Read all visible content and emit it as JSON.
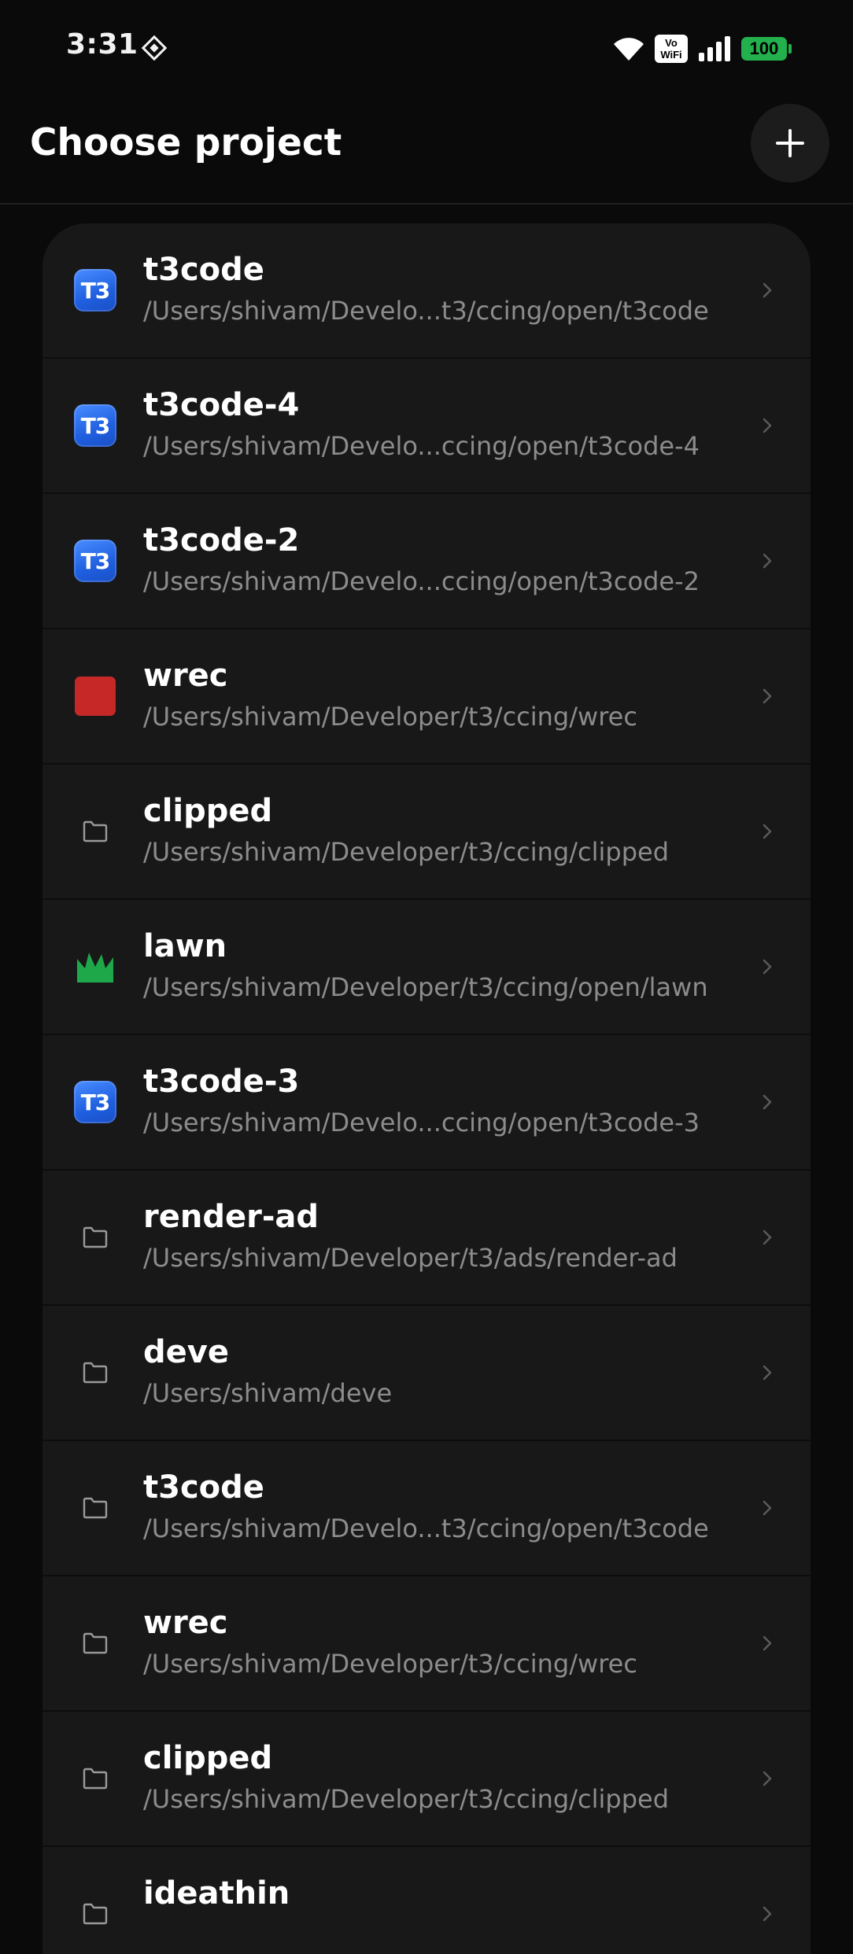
{
  "status_bar": {
    "time": "3:31",
    "vowifi_top": "Vo",
    "vowifi_bottom": "WiFi",
    "battery": "100",
    "icons": [
      "app-notification-icon",
      "wifi-icon",
      "vowifi-icon",
      "signal-icon",
      "battery-icon"
    ]
  },
  "header": {
    "title": "Choose project",
    "add_icon": "plus-icon"
  },
  "colors": {
    "background": "#0a0a0a",
    "card": "#181818",
    "path_text": "#8c8c8c",
    "battery": "#22b14c",
    "t3_blue": "#2a6cf0",
    "wrec_red": "#c62828",
    "lawn_green": "#1fa84a"
  },
  "projects": [
    {
      "name": "t3code",
      "path": "/Users/shivam/Develo...t3/ccing/open/t3code",
      "icon": "t3-icon"
    },
    {
      "name": "t3code-4",
      "path": "/Users/shivam/Develo...ccing/open/t3code-4",
      "icon": "t3-icon"
    },
    {
      "name": "t3code-2",
      "path": "/Users/shivam/Develo...ccing/open/t3code-2",
      "icon": "t3-icon"
    },
    {
      "name": "wrec",
      "path": "/Users/shivam/Developer/t3/ccing/wrec",
      "icon": "red-square-icon"
    },
    {
      "name": "clipped",
      "path": "/Users/shivam/Developer/t3/ccing/clipped",
      "icon": "folder-icon"
    },
    {
      "name": "lawn",
      "path": "/Users/shivam/Developer/t3/ccing/open/lawn",
      "icon": "grass-icon"
    },
    {
      "name": "t3code-3",
      "path": "/Users/shivam/Develo...ccing/open/t3code-3",
      "icon": "t3-icon"
    },
    {
      "name": "render-ad",
      "path": "/Users/shivam/Developer/t3/ads/render-ad",
      "icon": "folder-icon"
    },
    {
      "name": "deve",
      "path": "/Users/shivam/deve",
      "icon": "folder-icon"
    },
    {
      "name": "t3code",
      "path": "/Users/shivam/Develo...t3/ccing/open/t3code",
      "icon": "folder-icon"
    },
    {
      "name": "wrec",
      "path": "/Users/shivam/Developer/t3/ccing/wrec",
      "icon": "folder-icon"
    },
    {
      "name": "clipped",
      "path": "/Users/shivam/Developer/t3/ccing/clipped",
      "icon": "folder-icon"
    },
    {
      "name": "ideathin",
      "path": "",
      "icon": "folder-icon"
    }
  ],
  "t3_icon_label": "T3"
}
